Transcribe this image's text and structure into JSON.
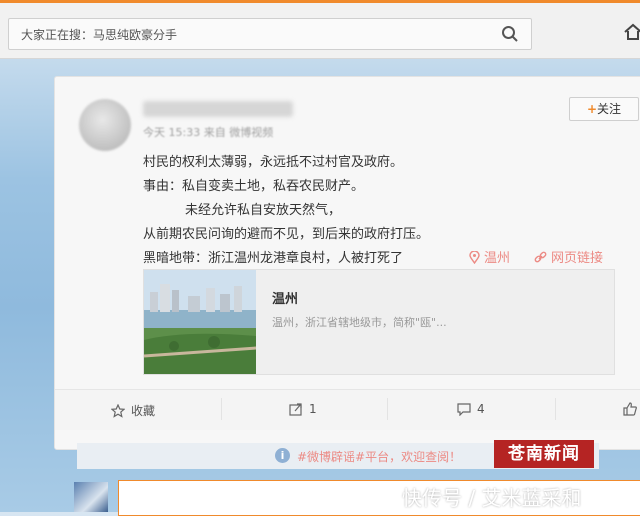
{
  "search": {
    "placeholder": "大家正在搜：马思纯欧豪分手"
  },
  "post": {
    "meta": "今天 15:33 来自 微博视频",
    "follow_label": "关注",
    "lines": [
      "村民的权利太薄弱，永远抵不过村官及政府。",
      "事由：私自变卖土地，私吞农民财产。",
      "未经允许私自安放天然气，",
      "从前期农民问询的避而不见，到后来的政府打压。",
      "黑暗地带：浙江温州龙港章良村，人被打死了"
    ],
    "location": "温州",
    "web_link": "网页链接",
    "preview": {
      "title": "温州",
      "description": "温州，浙江省辖地级市，简称\"瓯\"..."
    }
  },
  "actions": {
    "favorite": "收藏",
    "repost_count": "1",
    "comment_count": "4"
  },
  "notice": {
    "text": "#微博辟谣#平台，欢迎查阅！"
  },
  "badge": {
    "text": "苍南新闻"
  },
  "watermark": {
    "text": "快传号 / 艾米蓝采和"
  },
  "colors": {
    "accent": "#f08a2c",
    "link": "#ec8a84",
    "badge": "#b52423"
  }
}
